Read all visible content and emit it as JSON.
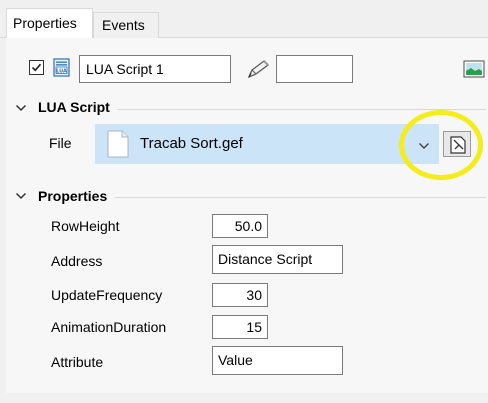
{
  "tabs": [
    {
      "label": "Properties",
      "active": true
    },
    {
      "label": "Events",
      "active": false
    }
  ],
  "header": {
    "enabled_checked": true,
    "name_value": "LUA Script 1",
    "second_value": ""
  },
  "lua_section": {
    "title": "LUA Script",
    "file_label": "File",
    "file_value": "Tracab Sort.gef"
  },
  "properties_section": {
    "title": "Properties",
    "rows": [
      {
        "label": "RowHeight",
        "value": "50.0"
      },
      {
        "label": "Address",
        "value": "Distance Script"
      },
      {
        "label": "UpdateFrequency",
        "value": "30"
      },
      {
        "label": "AnimationDuration",
        "value": "15"
      },
      {
        "label": "Attribute",
        "value": "Value"
      }
    ]
  },
  "colors": {
    "selected_row": "#cce4f7",
    "highlight_ring": "#f4ec1b",
    "panel_background": "#f7f7f7"
  },
  "icons": {
    "checkbox": "checkmark-icon",
    "script_type": "lua-script-icon",
    "edit": "pencil-icon",
    "picture": "picture-icon",
    "file": "file-icon",
    "dropdown": "chevron-down-icon",
    "browse": "browse-file-icon",
    "collapse": "chevron-down-icon"
  }
}
